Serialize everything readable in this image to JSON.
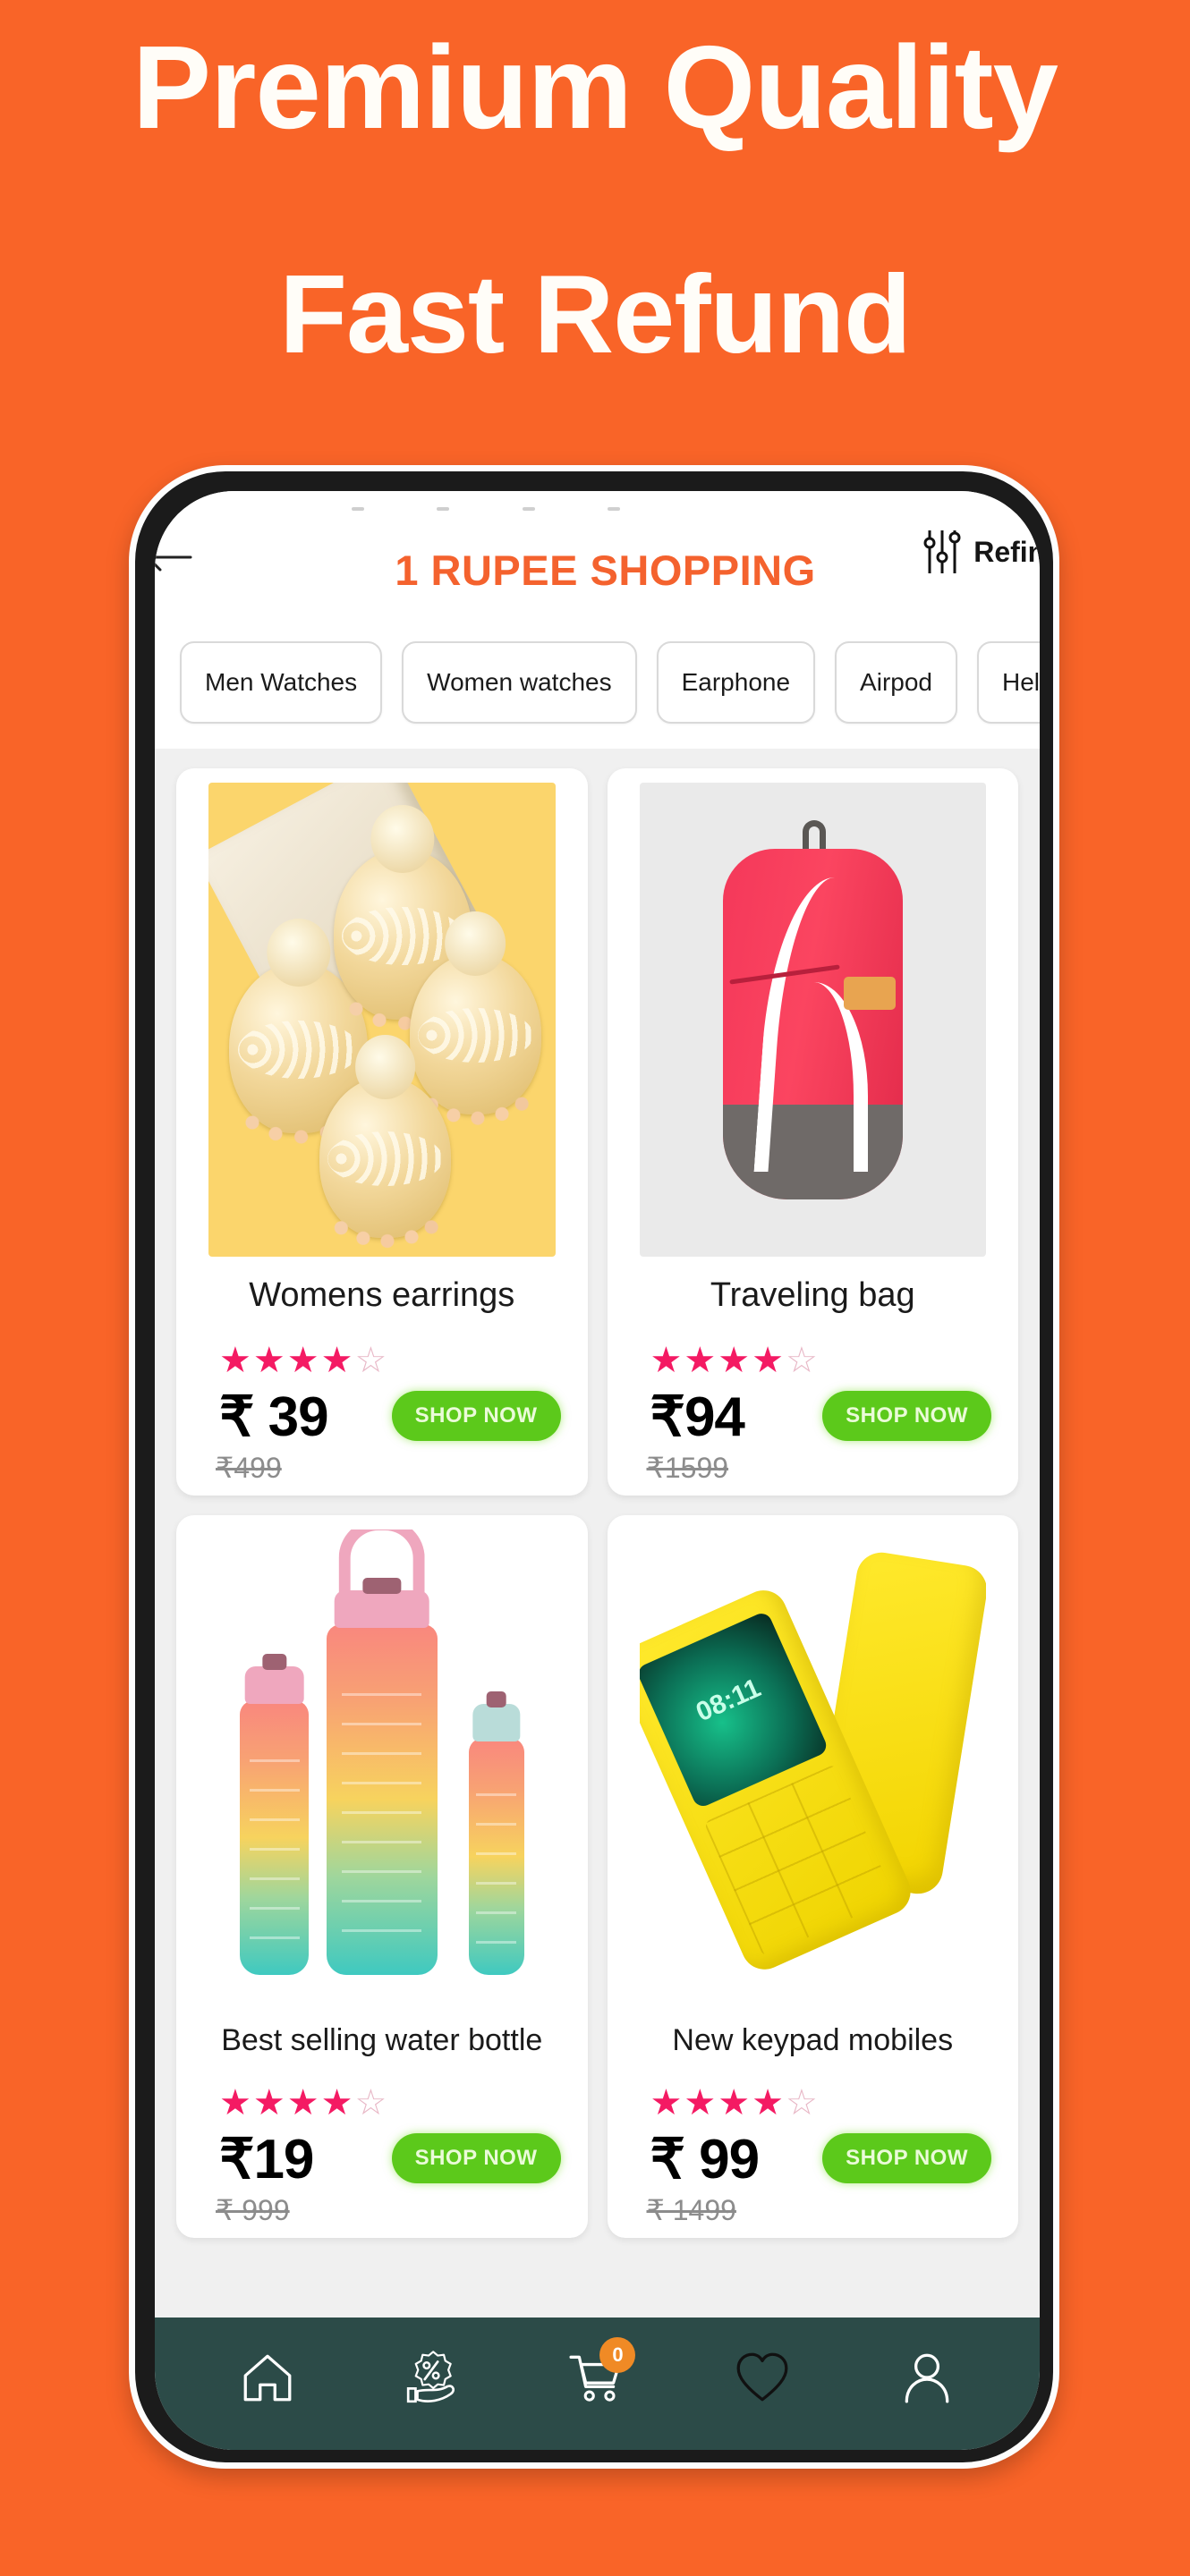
{
  "promo": {
    "line1": "Premium Quality",
    "line2": "Fast Refund"
  },
  "colors": {
    "background_orange": "#F96428",
    "brand_orange": "#F4622E",
    "shop_button_green": "#5CC91B",
    "nav_bar_teal": "#2C4B48",
    "star_pink": "#F41A63",
    "badge_orange": "#F08A25"
  },
  "appbar": {
    "title": "1 RUPEE SHOPPING",
    "back_icon": "back-arrow-icon",
    "refine_label": "Refine",
    "refine_icon": "sliders-icon"
  },
  "categories": [
    {
      "label": "Men Watches"
    },
    {
      "label": "Women watches"
    },
    {
      "label": "Earphone"
    },
    {
      "label": "Airpod"
    },
    {
      "label": "Helmets"
    }
  ],
  "products": [
    {
      "title": "Womens earrings",
      "price": "₹ 39",
      "mrp": "₹499",
      "rating_filled": 4,
      "rating_total": 5,
      "cta": "SHOP NOW",
      "image": "womens-earrings-photo"
    },
    {
      "title": "Traveling bag",
      "price": "₹94",
      "mrp": "₹1599",
      "rating_filled": 4,
      "rating_total": 5,
      "cta": "SHOP NOW",
      "image": "traveling-bag-photo"
    },
    {
      "title": "Best selling water bottle",
      "price": "₹19",
      "mrp": "₹ 999",
      "rating_filled": 4,
      "rating_total": 5,
      "cta": "SHOP NOW",
      "image": "water-bottle-photo"
    },
    {
      "title": "New keypad  mobiles",
      "price": "₹ 99",
      "mrp": "₹ 1499",
      "rating_filled": 4,
      "rating_total": 5,
      "cta": "SHOP NOW",
      "image": "keypad-mobile-photo",
      "screen_time": "08:11"
    }
  ],
  "bottom_nav": [
    {
      "icon": "home-icon"
    },
    {
      "icon": "offers-percent-hand-icon"
    },
    {
      "icon": "cart-icon",
      "badge": "0"
    },
    {
      "icon": "heart-icon"
    },
    {
      "icon": "profile-icon"
    }
  ]
}
